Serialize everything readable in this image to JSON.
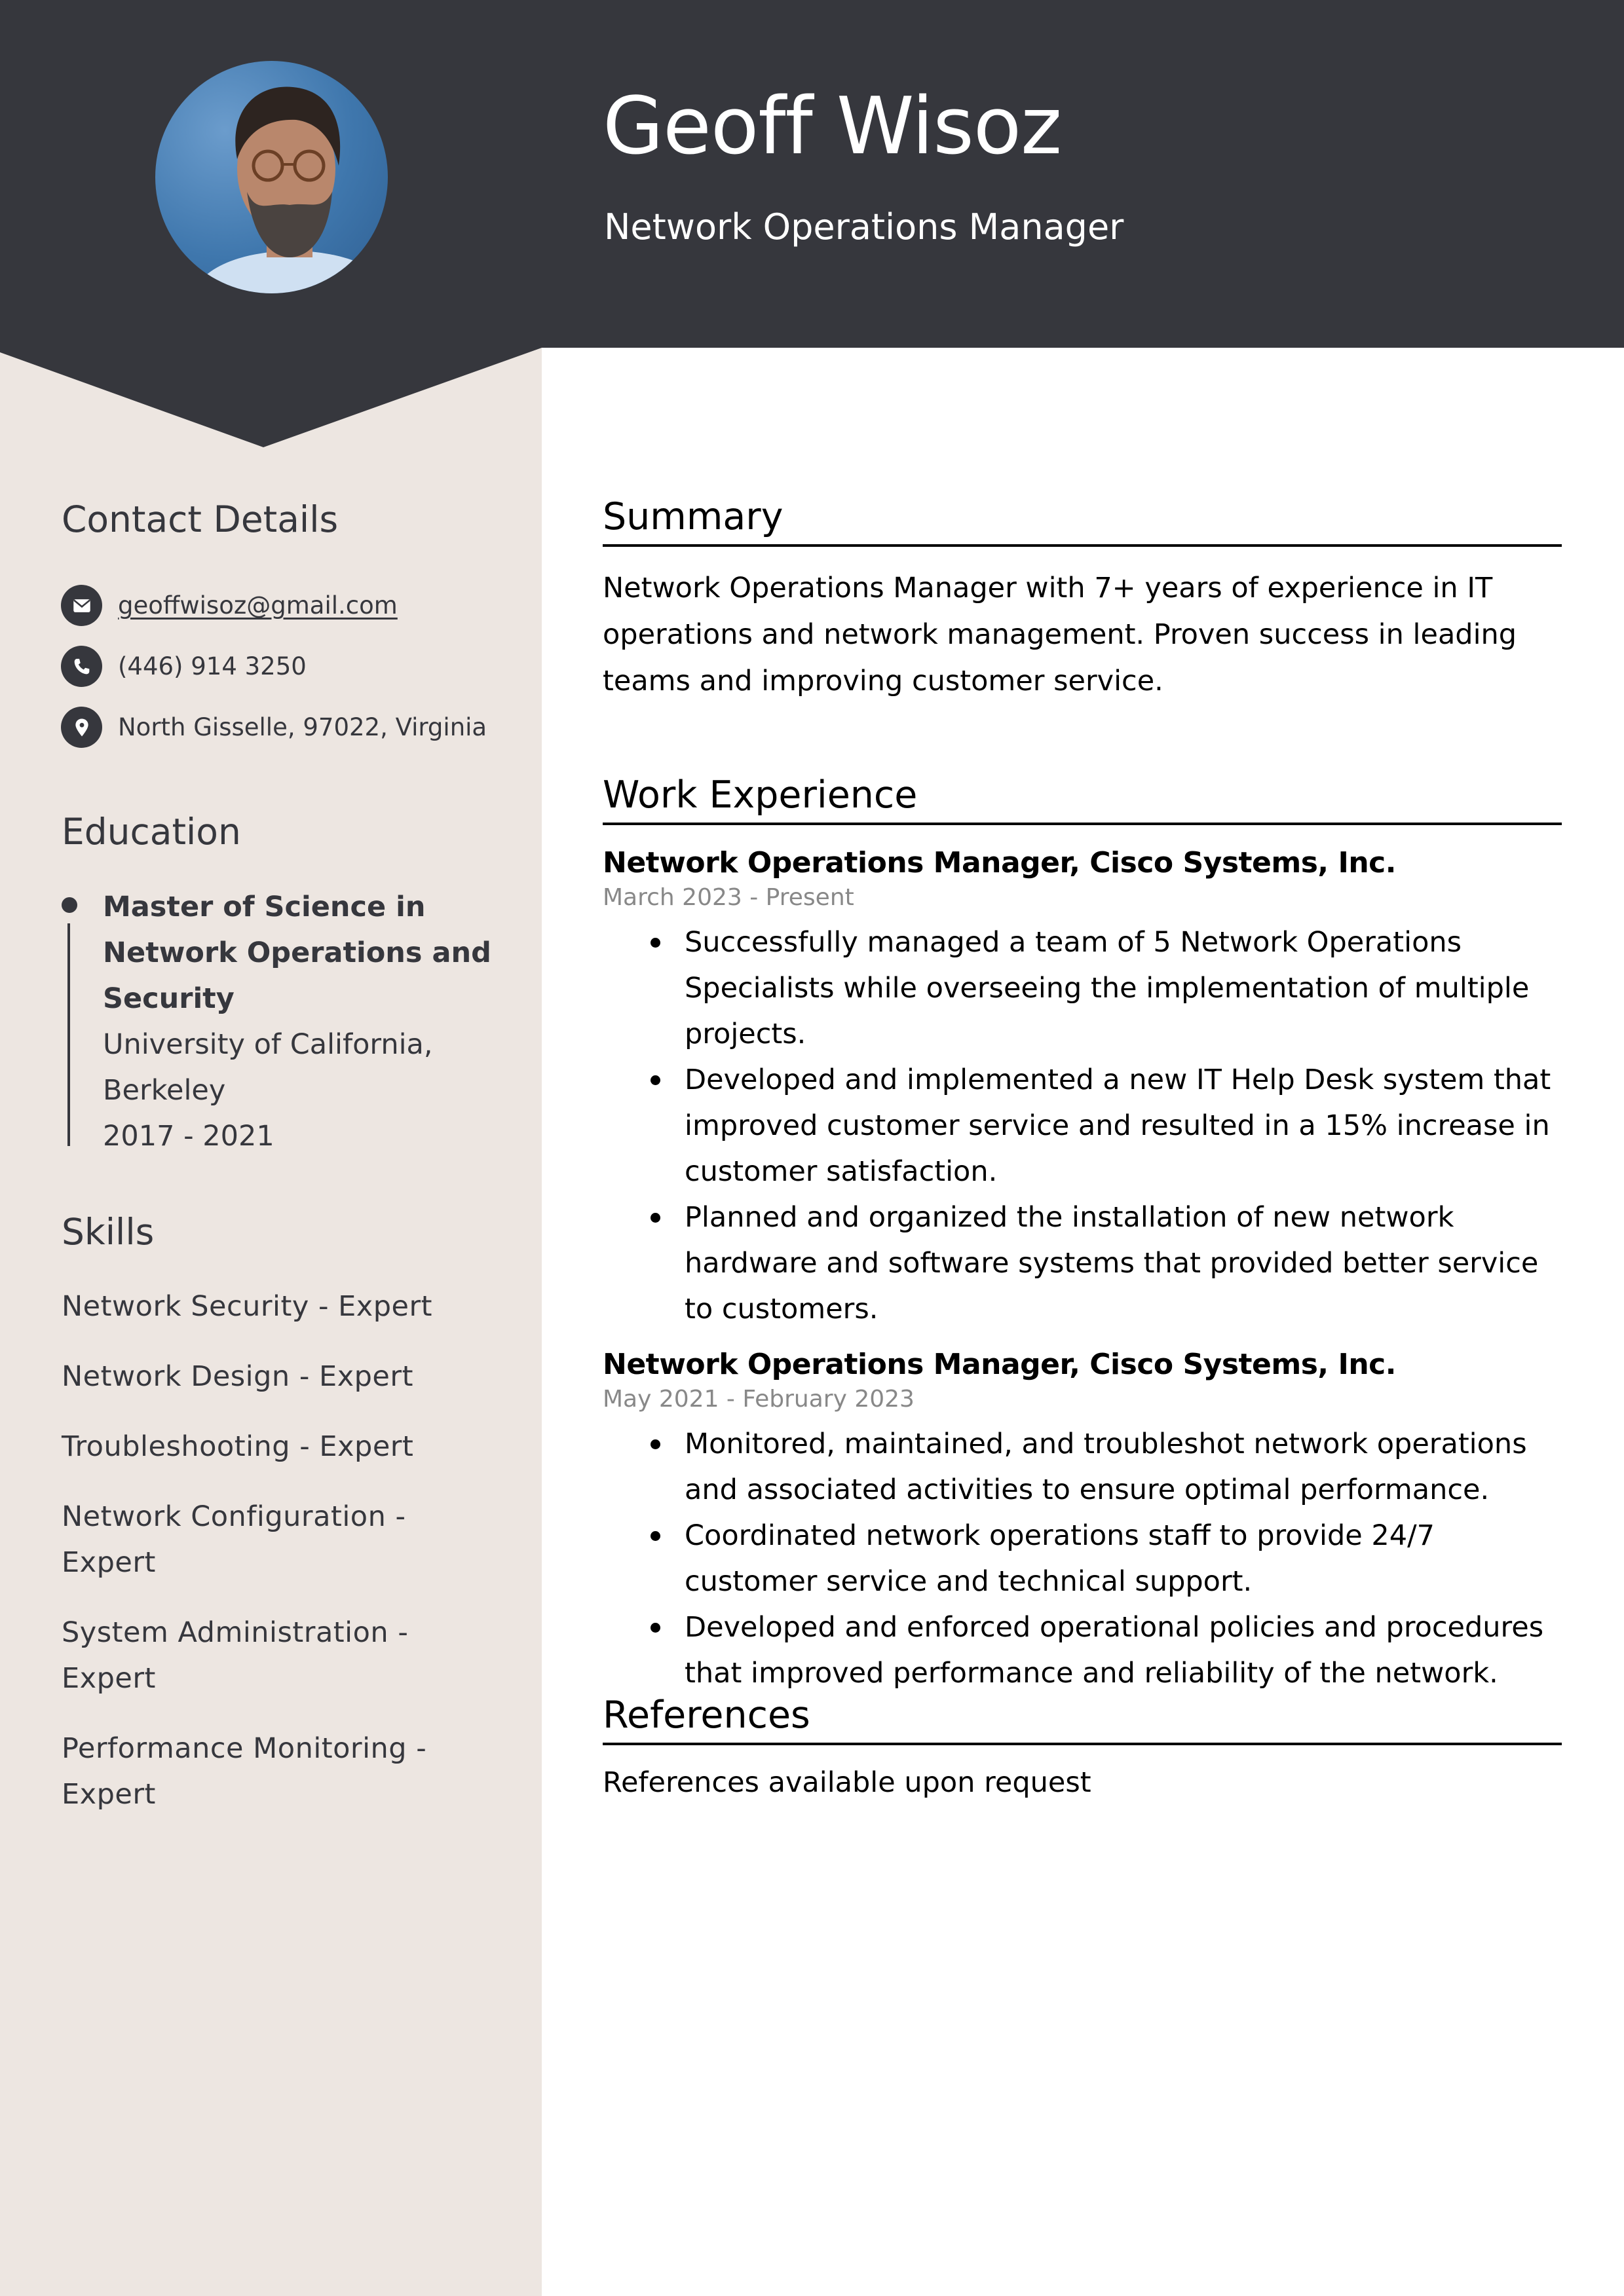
{
  "header": {
    "name": "Geoff Wisoz",
    "title": "Network Operations Manager",
    "photo_alt": "profile-photo"
  },
  "colors": {
    "header_bg": "#36373d",
    "sidebar_bg": "#ede6e1",
    "text_dark": "#36373d",
    "date_gray": "#888888"
  },
  "sidebar": {
    "contact": {
      "heading": "Contact Details",
      "items": [
        {
          "icon": "envelope-icon",
          "text": "geoffwisoz@gmail.com"
        },
        {
          "icon": "phone-icon",
          "text": "(446) 914 3250"
        },
        {
          "icon": "location-pin-icon",
          "text": "North Gisselle, 97022, Virginia"
        }
      ]
    },
    "education": {
      "heading": "Education",
      "degree": "Master of Science in Network Operations and Security",
      "school": "University of California, Berkeley",
      "years": "2017 - 2021"
    },
    "skills": {
      "heading": "Skills",
      "items": [
        "Network Security - Expert",
        "Network Design - Expert",
        "Troubleshooting - Expert",
        "Network Configuration - Expert",
        "System Administration - Expert",
        "Performance Monitoring - Expert"
      ]
    }
  },
  "main": {
    "summary": {
      "heading": "Summary",
      "text": "Network Operations Manager with 7+ years of experience in IT operations and network management. Proven success in leading teams and improving customer service."
    },
    "experience": {
      "heading": "Work Experience",
      "jobs": [
        {
          "title": "Network Operations Manager, Cisco Systems, Inc.",
          "dates": "March 2023 - Present",
          "bullets": [
            "Successfully managed a team of 5 Network Operations Specialists while overseeing the implementation of multiple projects.",
            "Developed and implemented a new IT Help Desk system that improved customer service and resulted in a 15% increase in customer satisfaction.",
            "Planned and organized the installation of new network hardware and software systems that provided better service to customers."
          ]
        },
        {
          "title": "Network Operations Manager, Cisco Systems, Inc.",
          "dates": "May 2021 - February 2023",
          "bullets": [
            "Monitored, maintained, and troubleshot network operations and associated activities to ensure optimal performance.",
            "Coordinated network operations staff to provide 24/7 customer service and technical support.",
            "Developed and enforced operational policies and procedures that improved performance and reliability of the network."
          ]
        }
      ]
    },
    "references": {
      "heading": "References",
      "text": "References available upon request"
    }
  }
}
